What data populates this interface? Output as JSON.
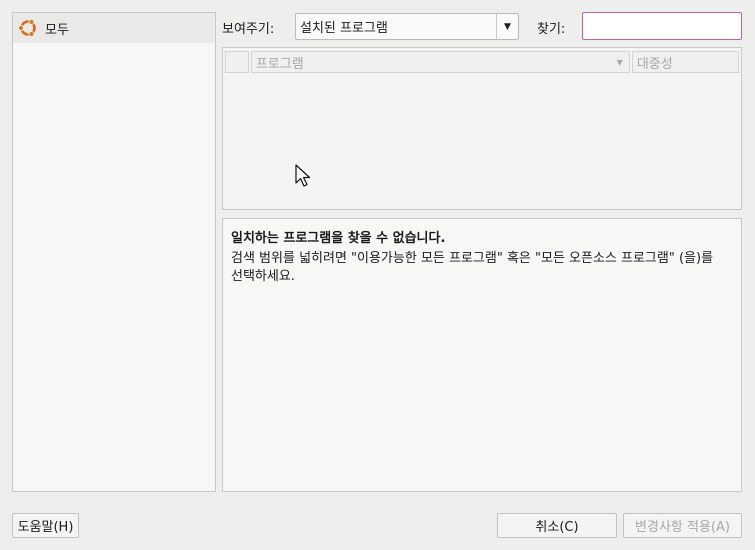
{
  "sidebar": {
    "items": [
      {
        "label": "모두",
        "icon": "ubuntu-logo-icon",
        "selected": true
      }
    ]
  },
  "filter": {
    "show_label": "보여주기:",
    "selected": "설치된 프로그램"
  },
  "search": {
    "label": "찾기:",
    "value": ""
  },
  "table": {
    "columns": {
      "program": "프로그램",
      "popularity": "대중성"
    },
    "rows": []
  },
  "description": {
    "title": "일치하는 프로그램을 찾을 수 없습니다.",
    "body": "검색 범위를 넓히려면 \"이용가능한 모든 프로그램\" 혹은 \"모든 오픈소스 프로그램\" (을)를 선택하세요."
  },
  "buttons": {
    "help": "도움말(H)",
    "cancel": "취소(C)",
    "apply": "변경사항 적용(A)"
  },
  "colors": {
    "window_bg": "#eeeeec",
    "search_focus_border": "#c060b0",
    "disabled_text": "#a8a8a4"
  }
}
